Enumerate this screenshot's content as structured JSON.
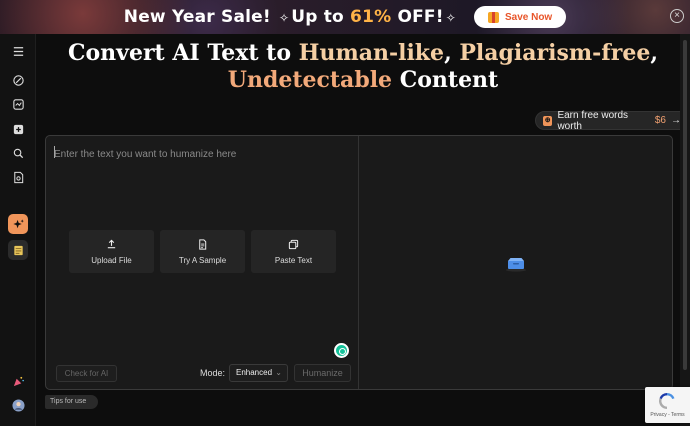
{
  "banner": {
    "text_part1": "New Year Sale! ",
    "text_part2": "Up to ",
    "discount": "61%",
    "text_part3": " OFF!",
    "spark": "✧",
    "cta": "Save Now",
    "close": "×"
  },
  "hero": {
    "line1_a": "Convert AI Text to ",
    "line1_b": "Human-like",
    "line1_c": ", ",
    "line1_d": "Plagiarism-free",
    "line1_e": ",",
    "line2_a": "Undetectable",
    "line2_b": " Content"
  },
  "earn": {
    "badge": "⊕",
    "label": "Earn free words worth",
    "amount": "$6",
    "arrow": "→"
  },
  "editor": {
    "placeholder": "Enter the text you want to humanize here",
    "actions": [
      {
        "label": "Upload File",
        "icon": "upload-icon"
      },
      {
        "label": "Try A Sample",
        "icon": "document-icon"
      },
      {
        "label": "Paste Text",
        "icon": "copy-icon"
      }
    ],
    "check_button": "Check for AI",
    "mode_label": "Mode:",
    "mode_value": "Enhanced",
    "humanize_button": "Humanize"
  },
  "tips": "Tips for use",
  "recaptcha": "Privacy - Terms",
  "colors": {
    "accent": "#f0955a",
    "highlight_peach": "#f5cfa4",
    "highlight_orange": "#f2a97a",
    "banner_discount": "#ffb347"
  }
}
